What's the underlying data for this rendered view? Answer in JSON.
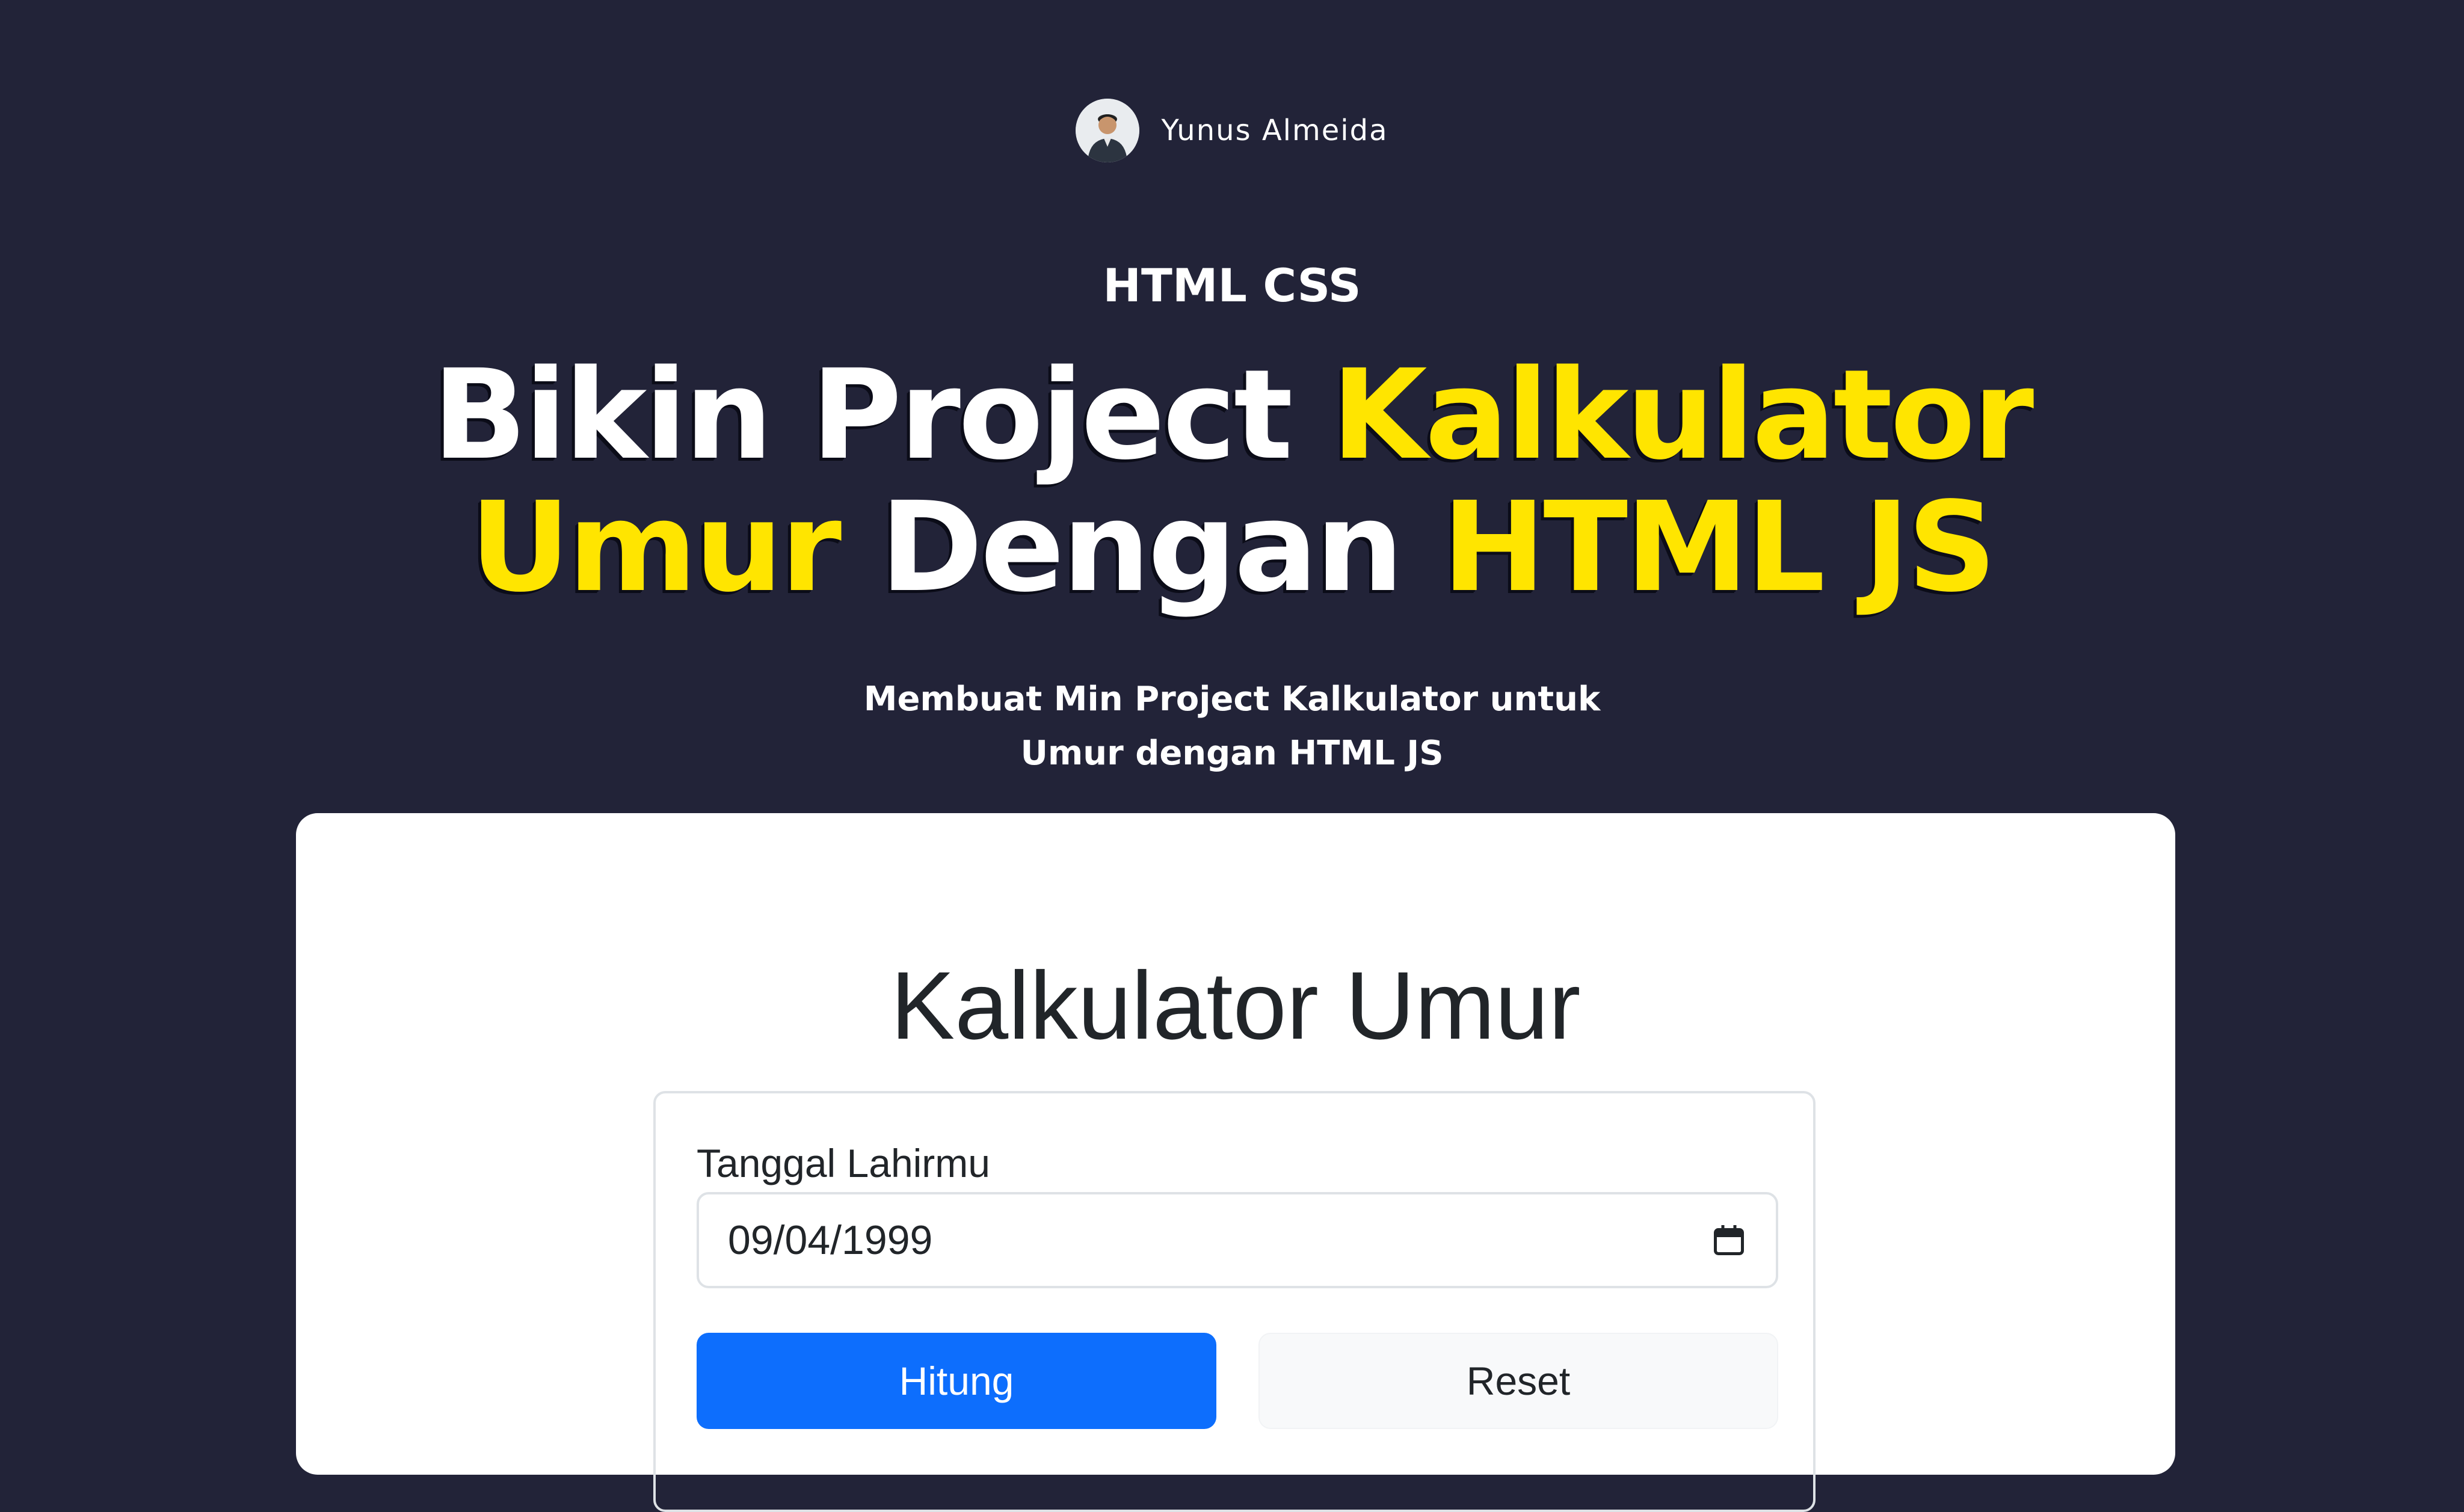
{
  "author": {
    "name": "Yunus Almeida",
    "avatar_icon": "person-avatar"
  },
  "category": "HTML CSS",
  "headline": {
    "line1": {
      "part1": "Bikin Project ",
      "part2": "Kalkulator"
    },
    "line2": {
      "part1": "Umur",
      "part2": " Dengan ",
      "part3": "HTML JS"
    },
    "highlight_color": "#ffe500"
  },
  "subtitle": {
    "line1": "Membuat Min Project Kalkulator untuk",
    "line2": "Umur dengan HTML JS"
  },
  "app": {
    "title": "Kalkulator Umur",
    "field_label": "Tanggal Lahirmu",
    "date_value": "09/04/1999",
    "calendar_icon": "calendar-icon",
    "hitung_label": "Hitung",
    "reset_label": "Reset",
    "primary_color": "#0d6efd"
  },
  "colors": {
    "background": "#222338",
    "card": "#ffffff"
  }
}
